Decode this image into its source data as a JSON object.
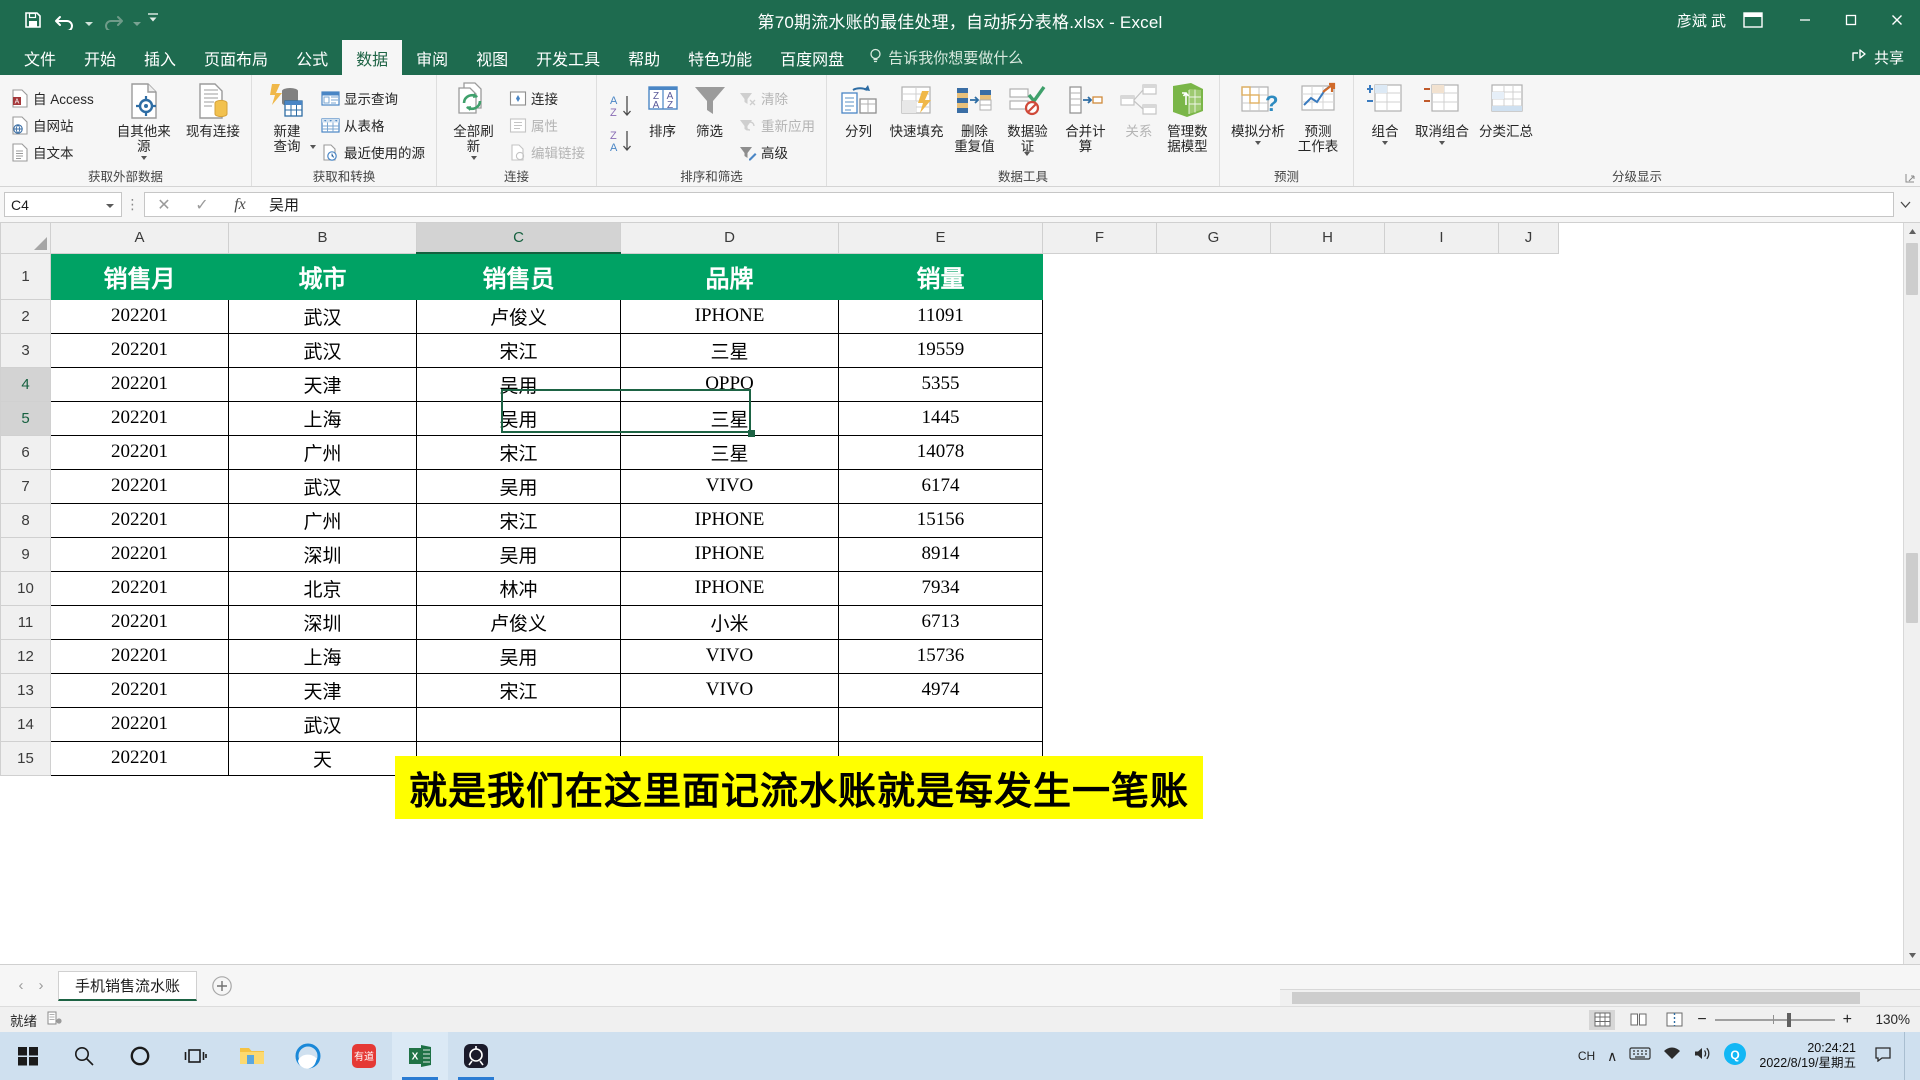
{
  "titlebar": {
    "document_title": "第70期流水账的最佳处理，自动拆分表格.xlsx  -  Excel",
    "user_name": "彦斌 武",
    "save_icon": "save-icon",
    "undo_icon": "undo-icon",
    "redo_icon": "redo-icon",
    "customize_icon": "customize-quick-access-icon",
    "ribbon_display_icon": "ribbon-display-options-icon",
    "minimize_label": "–",
    "restore_label": "❐",
    "close_label": "✕"
  },
  "tabs": [
    {
      "label": "文件",
      "active": false
    },
    {
      "label": "开始",
      "active": false
    },
    {
      "label": "插入",
      "active": false
    },
    {
      "label": "页面布局",
      "active": false
    },
    {
      "label": "公式",
      "active": false
    },
    {
      "label": "数据",
      "active": true
    },
    {
      "label": "审阅",
      "active": false
    },
    {
      "label": "视图",
      "active": false
    },
    {
      "label": "开发工具",
      "active": false
    },
    {
      "label": "帮助",
      "active": false
    },
    {
      "label": "特色功能",
      "active": false
    },
    {
      "label": "百度网盘",
      "active": false
    }
  ],
  "tellme": {
    "label": "告诉我你想要做什么",
    "icon": "lightbulb-icon"
  },
  "share": {
    "label": "共享",
    "icon": "share-icon"
  },
  "ribbon": {
    "groups": [
      {
        "label": "获取外部数据",
        "small_buttons": [
          "自 Access",
          "自网站",
          "自文本"
        ],
        "big_buttons": [
          {
            "label": "自其他来源",
            "dropdown": true,
            "disabled": false
          },
          {
            "label": "现有连接",
            "dropdown": false,
            "disabled": false
          }
        ]
      },
      {
        "label": "获取和转换",
        "big_buttons": [
          {
            "label": "新建\n查询",
            "dropdown": true,
            "disabled": false
          }
        ],
        "small_buttons": [
          "显示查询",
          "从表格",
          "最近使用的源"
        ]
      },
      {
        "label": "连接",
        "big_buttons": [
          {
            "label": "全部刷新",
            "dropdown": true,
            "disabled": false
          }
        ],
        "small_buttons": [
          "连接",
          "属性",
          "编辑链接"
        ],
        "disabled_small": [
          "属性",
          "编辑链接"
        ]
      },
      {
        "label": "排序和筛选",
        "sort_az": "升序排序",
        "sort_za": "降序排序",
        "big_buttons": [
          {
            "label": "排序",
            "dropdown": false,
            "disabled": false
          },
          {
            "label": "筛选",
            "dropdown": false,
            "disabled": false
          }
        ],
        "small_buttons": [
          "清除",
          "重新应用",
          "高级"
        ],
        "disabled_small": [
          "清除",
          "重新应用"
        ]
      },
      {
        "label": "数据工具",
        "big_buttons": [
          {
            "label": "分列",
            "dropdown": false,
            "disabled": false
          },
          {
            "label": "快速填充",
            "dropdown": false,
            "disabled": false
          },
          {
            "label": "删除\n重复值",
            "dropdown": false,
            "disabled": false
          },
          {
            "label": "数据验\n证",
            "dropdown": true,
            "disabled": false
          },
          {
            "label": "合并计算",
            "dropdown": false,
            "disabled": false
          },
          {
            "label": "关系",
            "dropdown": false,
            "disabled": true
          },
          {
            "label": "管理数\n据模型",
            "dropdown": false,
            "disabled": false
          }
        ]
      },
      {
        "label": "预测",
        "big_buttons": [
          {
            "label": "模拟分析",
            "dropdown": true,
            "disabled": false
          },
          {
            "label": "预测\n工作表",
            "dropdown": false,
            "disabled": false
          }
        ]
      },
      {
        "label": "分级显示",
        "big_buttons": [
          {
            "label": "组合",
            "dropdown": true,
            "disabled": false
          },
          {
            "label": "取消组合",
            "dropdown": true,
            "disabled": false
          },
          {
            "label": "分类汇总",
            "dropdown": false,
            "disabled": false
          }
        ]
      }
    ]
  },
  "formula_bar": {
    "name_box": "C4",
    "cancel_icon": "cancel-icon",
    "confirm_icon": "confirm-icon",
    "function_icon": "fx",
    "value": "吴用",
    "expand_icon": "expand-formula-bar-icon"
  },
  "sheet": {
    "column_headers": [
      "A",
      "B",
      "C",
      "D",
      "E",
      "F",
      "G",
      "H",
      "I",
      "J"
    ],
    "selected_column": "C",
    "selected_cell": "C4",
    "row_numbers": [
      1,
      2,
      3,
      4,
      5,
      6,
      7,
      8,
      9,
      10,
      11,
      12,
      13,
      14,
      15
    ],
    "table_headers": [
      "销售月",
      "城市",
      "销售员",
      "品牌",
      "销量"
    ],
    "rows": [
      [
        "202201",
        "武汉",
        "卢俊义",
        "IPHONE",
        "11091"
      ],
      [
        "202201",
        "武汉",
        "宋江",
        "三星",
        "19559"
      ],
      [
        "202201",
        "天津",
        "吴用",
        "OPPO",
        "5355"
      ],
      [
        "202201",
        "上海",
        "吴用",
        "三星",
        "1445"
      ],
      [
        "202201",
        "广州",
        "宋江",
        "三星",
        "14078"
      ],
      [
        "202201",
        "武汉",
        "吴用",
        "VIVO",
        "6174"
      ],
      [
        "202201",
        "广州",
        "宋江",
        "IPHONE",
        "15156"
      ],
      [
        "202201",
        "深圳",
        "吴用",
        "IPHONE",
        "8914"
      ],
      [
        "202201",
        "北京",
        "林冲",
        "IPHONE",
        "7934"
      ],
      [
        "202201",
        "深圳",
        "卢俊义",
        "小米",
        "6713"
      ],
      [
        "202201",
        "上海",
        "吴用",
        "VIVO",
        "15736"
      ],
      [
        "202201",
        "天津",
        "宋江",
        "VIVO",
        "4974"
      ],
      [
        "202201",
        "武汉",
        "",
        "",
        ""
      ],
      [
        "202201",
        "天",
        "",
        "",
        ""
      ]
    ]
  },
  "subtitle": {
    "text": "就是我们在这里面记流水账就是每发生一笔账"
  },
  "sheet_tabs": {
    "tabs": [
      {
        "label": "手机销售流水账",
        "active": true
      }
    ],
    "add_label": "+"
  },
  "status_bar": {
    "status": "就绪",
    "macro_icon": "record-macro-icon",
    "view_normal": "normal-view-icon",
    "view_layout": "page-layout-view-icon",
    "view_break": "page-break-view-icon",
    "zoom_out": "−",
    "zoom_in": "+",
    "zoom_value": "130%"
  },
  "taskbar": {
    "items": [
      {
        "name": "start-button",
        "label": "⊞"
      },
      {
        "name": "search-icon",
        "label": "🔍"
      },
      {
        "name": "cortana-icon",
        "label": "◯"
      },
      {
        "name": "task-view-icon",
        "label": "❐"
      },
      {
        "name": "file-explorer-icon",
        "label": ""
      },
      {
        "name": "browser-icon",
        "label": ""
      },
      {
        "name": "youdao-icon",
        "label": "有道"
      },
      {
        "name": "excel-icon",
        "label": "X"
      },
      {
        "name": "app-icon",
        "label": ""
      }
    ],
    "tray": {
      "ime": "CH",
      "chevron": "∧",
      "keyboard_icon": "keyboard-icon",
      "network_icon": "network-icon",
      "volume_icon": "volume-icon",
      "qq_icon": "qq-icon"
    },
    "clock": {
      "time": "20:24:21",
      "date": "2022/8/19/星期五"
    },
    "notification_icon": "notification-icon"
  }
}
